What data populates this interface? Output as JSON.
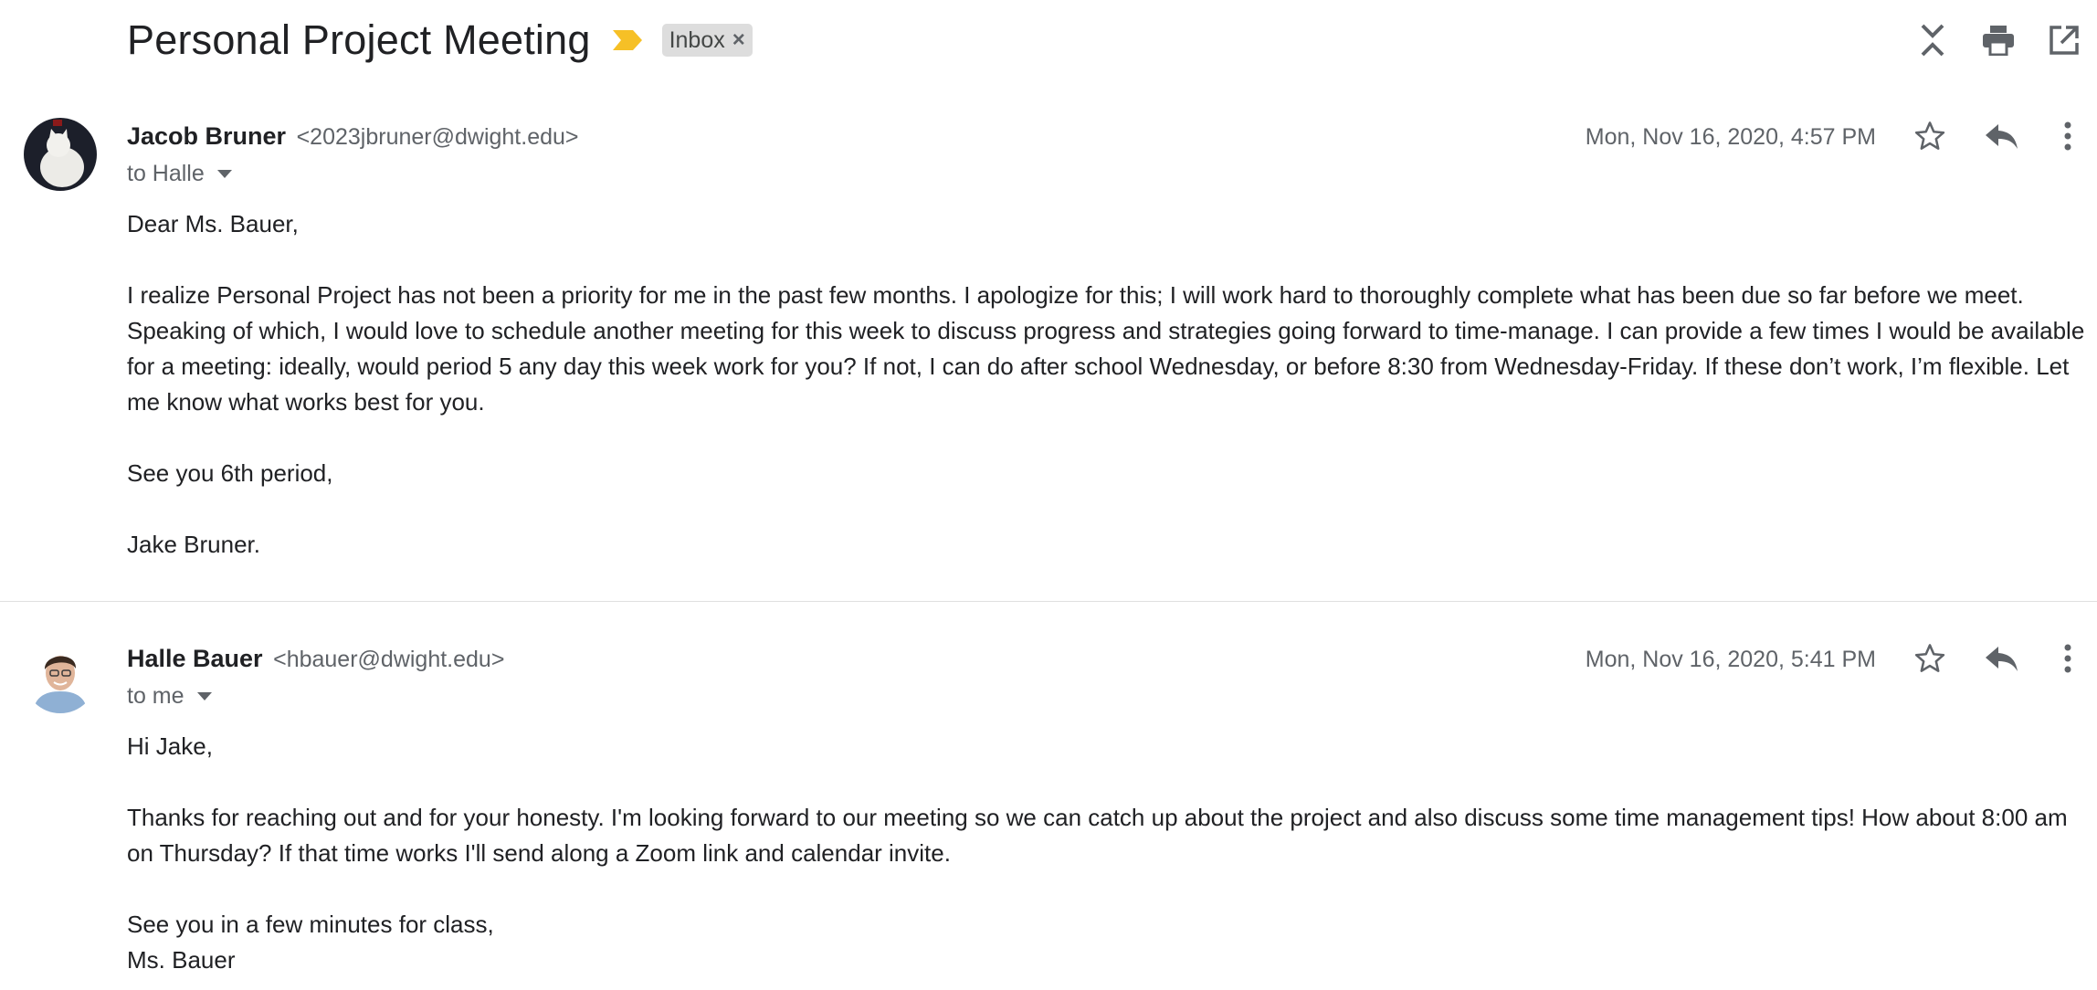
{
  "thread": {
    "subject": "Personal Project Meeting",
    "label": "Inbox",
    "label_remove": "×",
    "importance_color": "#f6c026",
    "actions": [
      {
        "icon": "collapse-all-icon"
      },
      {
        "icon": "print-icon"
      },
      {
        "icon": "open-in-new-window-icon"
      }
    ]
  },
  "messages": [
    {
      "sender_name": "Jacob Bruner",
      "sender_email": "<2023jbruner@dwight.edu>",
      "recipient": "to Halle",
      "date": "Mon, Nov 16, 2020, 4:57 PM",
      "avatar": "white-cat-avatar",
      "body": {
        "greeting": "Dear Ms. Bauer,",
        "paragraph": "I realize Personal Project has not been a priority for me in the past few months. I apologize for this; I will work hard to thoroughly complete what has been due so far before we meet. Speaking of which, I would love to schedule another meeting for this week to discuss progress and strategies going forward to time-manage. I can provide a few times I would be available for a meeting: ideally, would period 5 any day this week work for you? If not, I can do after school Wednesday, or before 8:30 from Wednesday-Friday. If these don’t work, I’m flexible. Let me know what works best for you.",
        "closing": "See you 6th period,",
        "signature": "Jake Bruner."
      }
    },
    {
      "sender_name": "Halle Bauer",
      "sender_email": "<hbauer@dwight.edu>",
      "recipient": "to me",
      "date": "Mon, Nov 16, 2020, 5:41 PM",
      "avatar": "person-photo-avatar",
      "body": {
        "greeting": "Hi Jake,",
        "paragraph": "Thanks for reaching out and for your honesty. I'm looking forward to our meeting so we can catch up about the project and also discuss some time management tips! How about 8:00 am on Thursday? If that time works I'll send along a Zoom link and calendar invite.",
        "closing": "See you in a few minutes for class,",
        "signature": "Ms. Bauer"
      }
    }
  ]
}
